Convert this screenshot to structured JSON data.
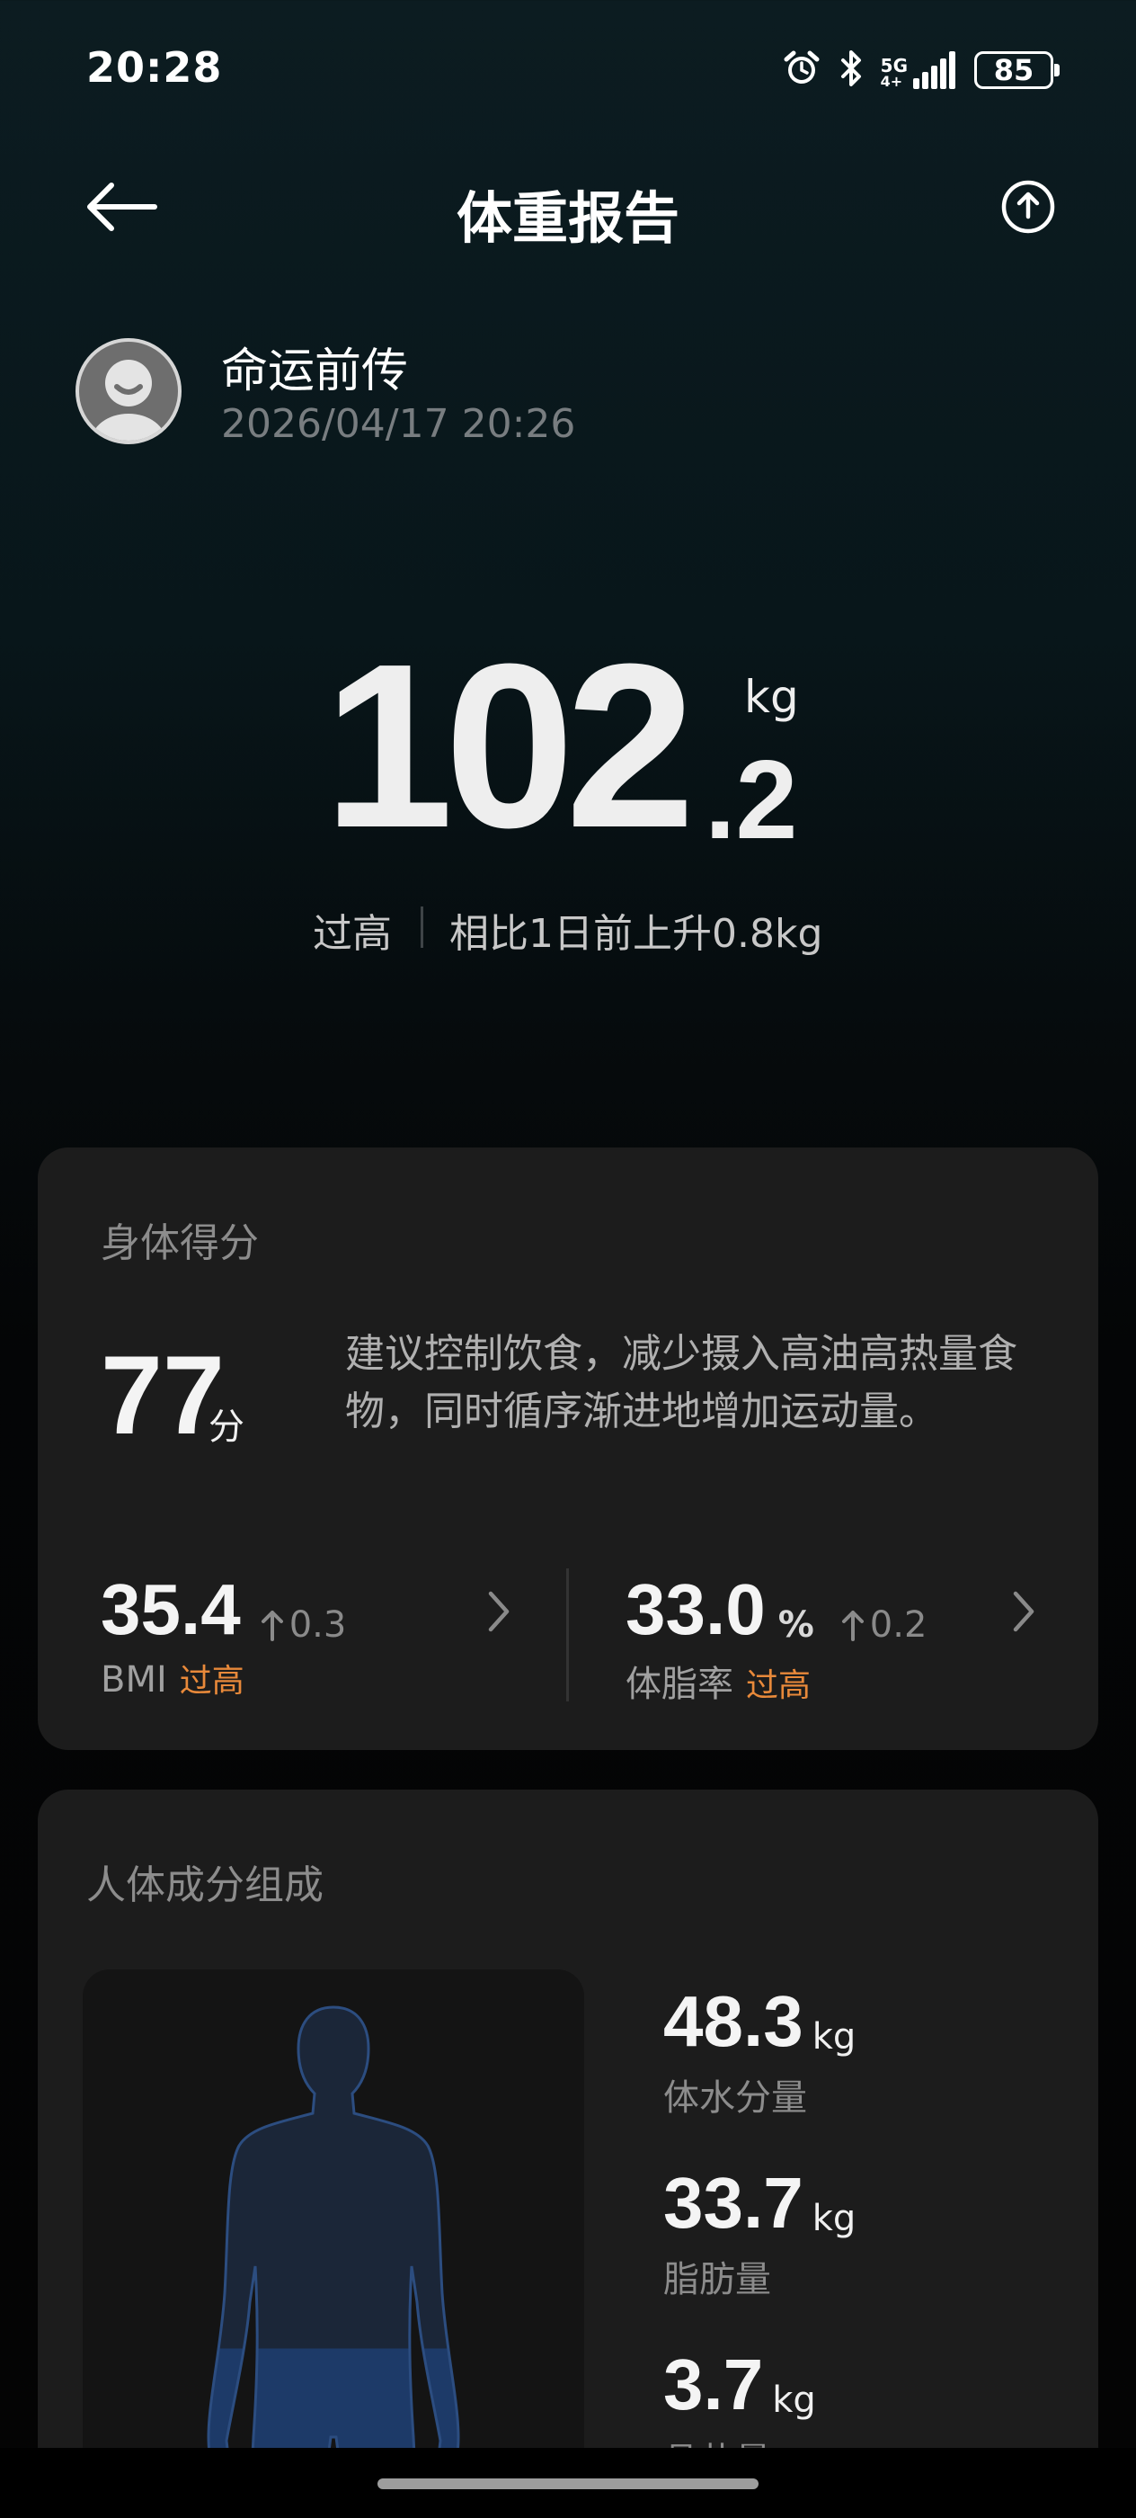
{
  "status_bar": {
    "time": "20:28",
    "network": "5G",
    "network_sub": "4+",
    "battery": "85",
    "icons": [
      "alarm-icon",
      "bluetooth-icon",
      "signal-icon",
      "battery-icon"
    ]
  },
  "header": {
    "title": "体重报告",
    "back_icon": "arrow-left-icon",
    "share_icon": "share-upload-icon"
  },
  "user": {
    "name": "命运前传",
    "datetime": "2026/04/17 20:26"
  },
  "weight": {
    "integer": "102",
    "decimal": ".2",
    "unit": "kg",
    "status": "过高",
    "compare": "相比1日前上升0.8kg"
  },
  "score_card": {
    "title": "身体得分",
    "score": "77",
    "score_unit": "分",
    "advice": "建议控制饮食，减少摄入高油高热量食物，同时循序渐进地增加运动量。",
    "bmi": {
      "value": "35.4",
      "delta": "0.3",
      "label": "BMI",
      "status": "过高"
    },
    "body_fat": {
      "value": "33.0",
      "unit": "%",
      "delta": "0.2",
      "label": "体脂率",
      "status": "过高"
    }
  },
  "composition_card": {
    "title": "人体成分组成",
    "items": [
      {
        "value": "48.3",
        "unit": "kg",
        "label": "体水分量"
      },
      {
        "value": "33.7",
        "unit": "kg",
        "label": "脂肪量"
      },
      {
        "value": "3.7",
        "unit": "kg",
        "label": "骨盐量"
      }
    ]
  },
  "colors": {
    "warning": "#e8893a",
    "card_bg": "#1c1c1c",
    "figure_fill": "#1e3a66"
  }
}
